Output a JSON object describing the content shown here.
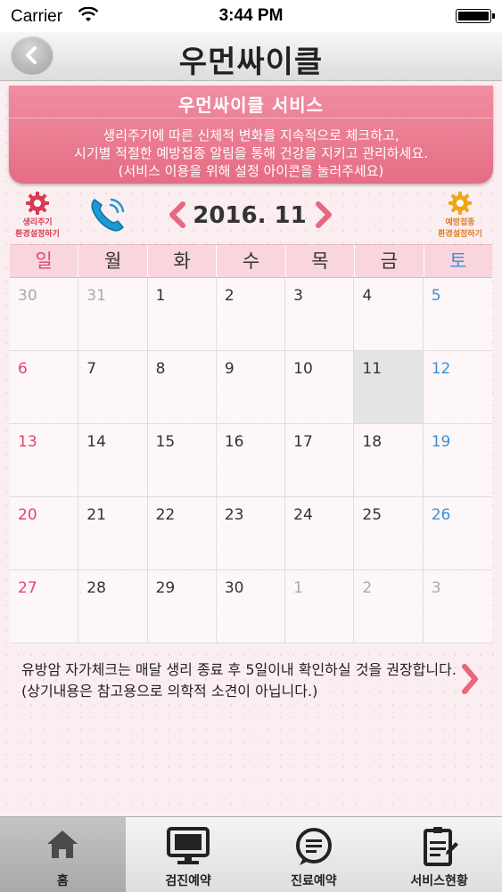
{
  "status_bar": {
    "carrier": "Carrier",
    "time": "3:44 PM"
  },
  "nav": {
    "title": "우먼싸이클"
  },
  "banner": {
    "heading": "우먼싸이클 서비스",
    "lines": [
      "생리주기에 따른 신체적 변화를 지속적으로 체크하고,",
      "시기별 적절한 예방접종 알림을 통해 건강을 지키고 관리하세요.",
      "(서비스 이용을 위해 설정 아이콘을 눌러주세요)"
    ]
  },
  "controls": {
    "cycle_settings": {
      "line1": "생리주기",
      "line2": "환경설정하기",
      "color": "#d83a4f",
      "icon": "gear-icon"
    },
    "vaccine_settings": {
      "line1": "예방접종",
      "line2": "환경설정하기",
      "color": "#e07a1e",
      "icon": "gear-icon"
    },
    "phone_icon": "phone-icon",
    "month_label": "2016. 11"
  },
  "calendar": {
    "weekdays": [
      "일",
      "월",
      "화",
      "수",
      "목",
      "금",
      "토"
    ],
    "weeks": [
      [
        "30",
        "31",
        "1",
        "2",
        "3",
        "4",
        "5"
      ],
      [
        "6",
        "7",
        "8",
        "9",
        "10",
        "11",
        "12"
      ],
      [
        "13",
        "14",
        "15",
        "16",
        "17",
        "18",
        "19"
      ],
      [
        "20",
        "21",
        "22",
        "23",
        "24",
        "25",
        "26"
      ],
      [
        "27",
        "28",
        "29",
        "30",
        "1",
        "2",
        "3"
      ]
    ],
    "other_month": [
      [
        0,
        0
      ],
      [
        0,
        1
      ],
      [
        4,
        4
      ],
      [
        4,
        5
      ],
      [
        4,
        6
      ]
    ],
    "today": [
      1,
      5
    ],
    "sunday_color": "#e0476a",
    "saturday_color": "#3b8fd6"
  },
  "notice": {
    "line1": "유방암 자가체크는 매달 생리 종료 후 5일이내 확인하실 것을 권장합니다.",
    "line2": "(상기내용은 참고용으로 의학적 소견이 아닙니다.)"
  },
  "tabs": [
    {
      "label": "홈",
      "icon": "home-icon",
      "active": true
    },
    {
      "label": "검진예약",
      "icon": "monitor-icon",
      "active": false
    },
    {
      "label": "진료예약",
      "icon": "chat-icon",
      "active": false
    },
    {
      "label": "서비스현황",
      "icon": "document-icon",
      "active": false
    }
  ]
}
